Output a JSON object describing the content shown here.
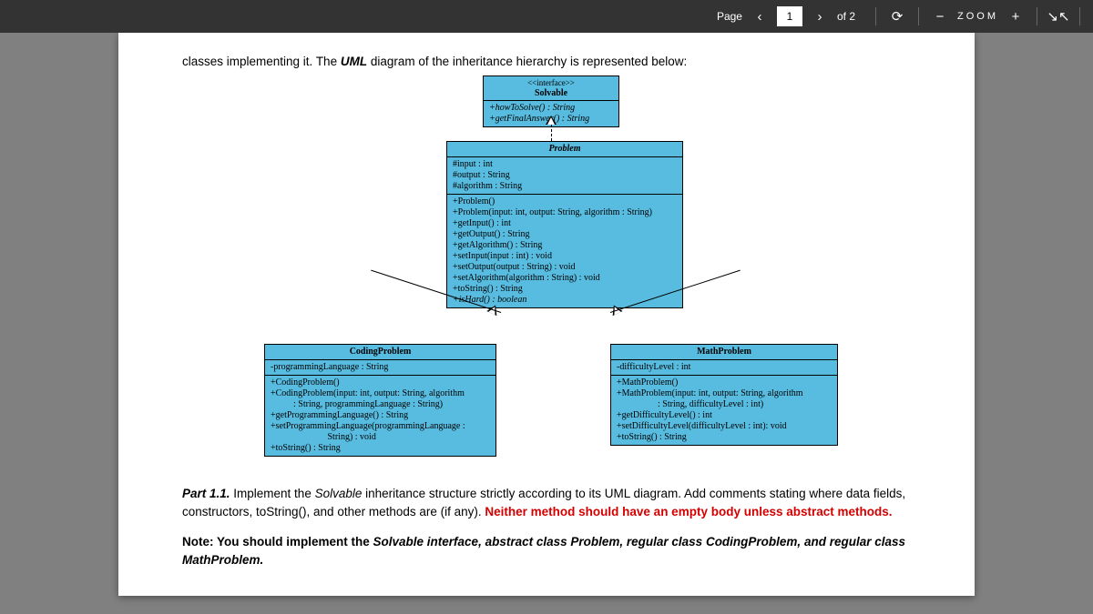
{
  "toolbar": {
    "page_label": "Page",
    "current_page": "1",
    "total_pages": "of 2",
    "zoom_label": "ZOOM"
  },
  "content": {
    "intro": "classes implementing it. The ",
    "intro_bold": "UML",
    "intro_rest": " diagram of the inheritance hierarchy is represented below:",
    "part_label": "Part 1.1.",
    "part_body_1": " Implement the ",
    "part_solvable": "Solvable",
    "part_body_2": " inheritance structure strictly according to its UML diagram. Add comments stating where data fields, constructors, toString(), and other methods are (if any).  ",
    "part_red": "Neither method should have an empty body unless abstract methods.",
    "note_prefix": "Note: You should implement the ",
    "note_ital": "Solvable interface, abstract class Problem, regular class CodingProblem, and regular class MathProblem."
  },
  "uml": {
    "solvable": {
      "stereo": "<<interface>>",
      "name": "Solvable",
      "methods": [
        "+howToSolve() : String",
        "+getFinalAnswer() : String"
      ]
    },
    "problem": {
      "name": "Problem",
      "fields": [
        "#input : int",
        "#output : String",
        "#algorithm : String"
      ],
      "methods": [
        "+Problem()",
        "+Problem(input: int, output: String, algorithm : String)",
        "+getInput() : int",
        "+getOutput() : String",
        "+getAlgorithm() : String",
        "+setInput(input : int) : void",
        "+setOutput(output : String) : void",
        "+setAlgorithm(algorithm : String) : void",
        "+toString() : String",
        "+isHard() : boolean"
      ]
    },
    "coding": {
      "name": "CodingProblem",
      "fields": [
        "-programmingLanguage : String"
      ],
      "methods": [
        "+CodingProblem()",
        "+CodingProblem(input: int, output: String, algorithm\n          : String, programmingLanguage : String)",
        "+getProgrammingLanguage() : String",
        "+setProgrammingLanguage(programmingLanguage :\n                         String) : void",
        "+toString() : String"
      ]
    },
    "math": {
      "name": "MathProblem",
      "fields": [
        "-difficultyLevel : int"
      ],
      "methods": [
        "+MathProblem()",
        "+MathProblem(input: int, output: String, algorithm\n                  : String, difficultyLevel : int)",
        "+getDifficultyLevel() : int",
        "+setDifficultyLevel(difficultyLevel : int): void",
        "+toString() : String"
      ]
    }
  }
}
